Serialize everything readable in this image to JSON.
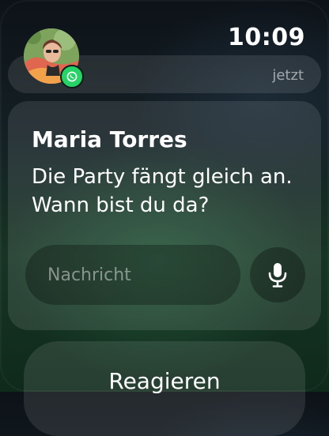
{
  "status": {
    "time": "10:09"
  },
  "notification": {
    "timestamp": "jetzt",
    "app_icon": "whatsapp-icon",
    "sender": "Maria Torres",
    "message": "Die Party fängt gleich an. Wann bist du da?",
    "reply": {
      "placeholder": "Nachricht",
      "mic_icon": "microphone-icon"
    },
    "react_label": "Reagieren"
  },
  "colors": {
    "whatsapp_green": "#25d366",
    "text_primary": "#ffffff",
    "text_secondary": "rgba(255,255,255,0.55)"
  }
}
